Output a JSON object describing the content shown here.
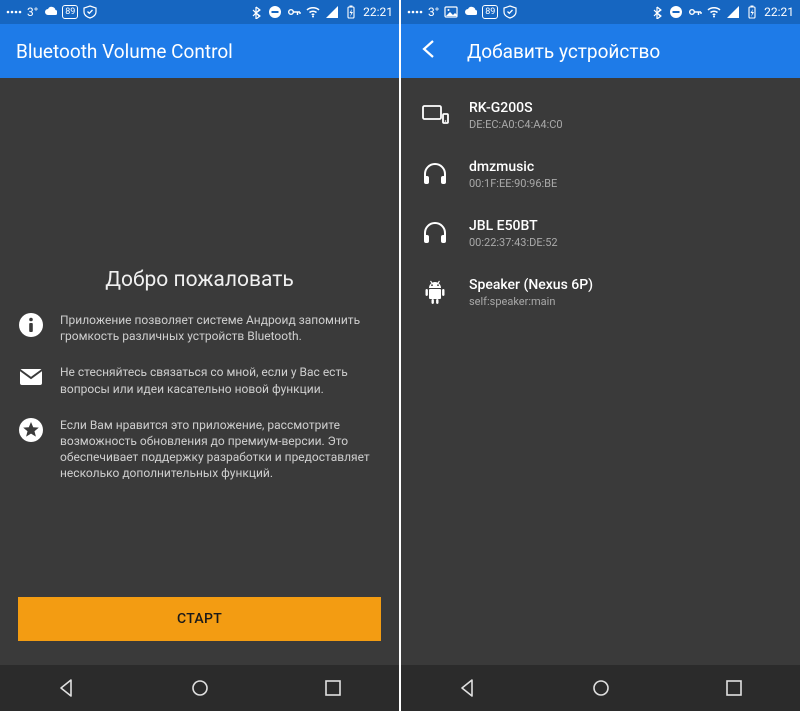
{
  "statusbar": {
    "temp": "3°",
    "badge": "89",
    "time": "22:21"
  },
  "left": {
    "appbar_title": "Bluetooth Volume Control",
    "welcome_title": "Добро пожаловать",
    "info1": "Приложение позволяет системе Андроид запомнить громкость различных устройств Bluetooth.",
    "info2": "Не стесняйтесь связаться со мной, если у Вас есть вопросы или идеи касательно новой функции.",
    "info3": "Если Вам нравится это приложение, рассмотрите возможность обновления до премиум-версии. Это обеспечивает поддержку разработки и предоставляет несколько дополнительных функций.",
    "start_label": "СТАРТ"
  },
  "right": {
    "appbar_title": "Добавить устройство",
    "devices": [
      {
        "name": "RK-G200S",
        "sub": "DE:EC:A0:C4:A4:C0",
        "icon": "display"
      },
      {
        "name": "dmzmusic",
        "sub": "00:1F:EE:90:96:BE",
        "icon": "headphones"
      },
      {
        "name": "JBL E50BT",
        "sub": "00:22:37:43:DE:52",
        "icon": "headphones"
      },
      {
        "name": "Speaker (Nexus 6P)",
        "sub": "self:speaker:main",
        "icon": "android"
      }
    ]
  }
}
